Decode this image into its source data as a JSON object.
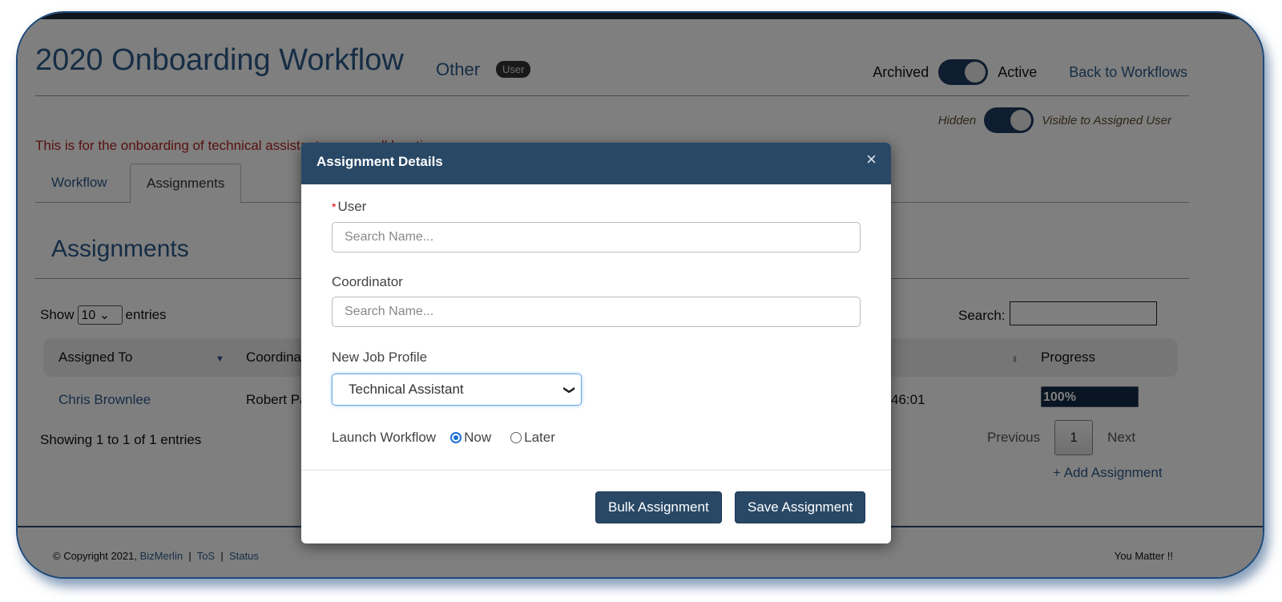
{
  "page": {
    "title": "2020 Onboarding Workflow",
    "category": "Other",
    "badge": "User",
    "status_toggle": {
      "off_label": "Archived",
      "on_label": "Active",
      "state": "on"
    },
    "back_link": "Back to Workflows",
    "visibility_toggle": {
      "off_label": "Hidden",
      "on_label": "Visible to Assigned User",
      "state": "on"
    },
    "description": "This is for the onboarding of technical assistants across all locations.",
    "tabs": [
      {
        "label": "Workflow",
        "active": false
      },
      {
        "label": "Assignments",
        "active": true
      }
    ],
    "section_title": "Assignments"
  },
  "table": {
    "show_label": "Show",
    "entries_value": "10",
    "entries_label": "entries",
    "search_label": "Search:",
    "search_value": "",
    "columns": [
      "Assigned To",
      "Coordinator",
      "Progress"
    ],
    "rows": [
      {
        "assigned_to": "Chris Brownlee",
        "coordinator": "Robert Pa",
        "date_partial": "46:01",
        "progress": "100%",
        "progress_pct": 100
      }
    ],
    "info": "Showing 1 to 1 of 1 entries",
    "pagination": {
      "previous": "Previous",
      "current": "1",
      "next": "Next"
    },
    "add_link": "+ Add Assignment"
  },
  "footer": {
    "copyright": "© Copyright 2021,",
    "brand_link": "BizMerlin",
    "sep": "|",
    "tos": "ToS",
    "status": "Status",
    "tagline": "You Matter !!"
  },
  "modal": {
    "title": "Assignment Details",
    "close_icon": "close-icon",
    "user_label": "User",
    "required_mark": "*",
    "user_placeholder": "Search Name...",
    "user_value": "",
    "coordinator_label": "Coordinator",
    "coordinator_placeholder": "Search Name...",
    "coordinator_value": "",
    "job_profile_label": "New Job Profile",
    "job_profile_value": "Technical Assistant",
    "launch_label": "Launch Workflow",
    "launch_options": [
      {
        "label": "Now",
        "checked": true
      },
      {
        "label": "Later",
        "checked": false
      }
    ],
    "bulk_button": "Bulk Assignment",
    "save_button": "Save Assignment"
  },
  "colors": {
    "primary": "#284866",
    "link": "#2c5b8a",
    "description": "#b22222",
    "progress": "#122a47"
  }
}
